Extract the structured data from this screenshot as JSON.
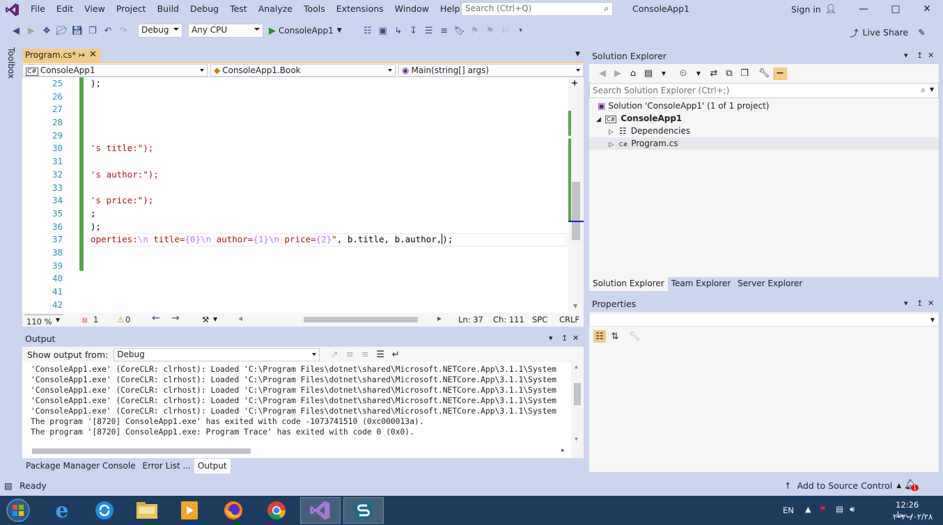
{
  "menubar": {
    "items": [
      "File",
      "Edit",
      "View",
      "Project",
      "Build",
      "Debug",
      "Test",
      "Analyze",
      "Tools",
      "Extensions",
      "Window",
      "Help"
    ],
    "search_placeholder": "Search (Ctrl+Q)",
    "app_title": "ConsoleApp1",
    "signin": "Sign in"
  },
  "toolbar": {
    "config": "Debug",
    "platform": "Any CPU",
    "run_target": "ConsoleApp1",
    "live_share": "Live Share"
  },
  "toolbox_label": "Toolbox",
  "editor": {
    "tab_label": "Program.cs*",
    "nav_project": "ConsoleApp1",
    "nav_class": "ConsoleApp1.Book",
    "nav_member": "Main(string[] args)",
    "line_numbers": [
      "25",
      "26",
      "27",
      "28",
      "29",
      "30",
      "31",
      "32",
      "33",
      "34",
      "35",
      "36",
      "37",
      "38",
      "39",
      "40",
      "41",
      "42"
    ],
    "lines": [
      ");",
      "",
      "",
      "",
      "",
      "'s title:\");",
      "",
      "'s author:\");",
      "",
      "'s price:\");",
      ";",
      ");",
      "",
      "",
      "",
      "",
      "",
      ""
    ],
    "line37": {
      "p1": "operties:",
      "p2": "\\n",
      "p3": " title=",
      "p4": "{0}",
      "p5": "\\n",
      "p6": " author=",
      "p7": "{1}",
      "p8": "\\n",
      "p9": " price=",
      "p10": "{2}",
      "p11": "\"",
      "p12": ", b.title, b.author,",
      "p13": ");"
    },
    "zoom": "110 %",
    "errors": "1",
    "warnings": "0",
    "ln": "Ln: 37",
    "ch": "Ch: 111",
    "spc": "SPC",
    "crlf": "CRLF"
  },
  "output": {
    "title": "Output",
    "show_from_label": "Show output from:",
    "source": "Debug",
    "lines": [
      "'ConsoleApp1.exe' (CoreCLR: clrhost): Loaded 'C:\\Program Files\\dotnet\\shared\\Microsoft.NETCore.App\\3.1.1\\System",
      "'ConsoleApp1.exe' (CoreCLR: clrhost): Loaded 'C:\\Program Files\\dotnet\\shared\\Microsoft.NETCore.App\\3.1.1\\System",
      "'ConsoleApp1.exe' (CoreCLR: clrhost): Loaded 'C:\\Program Files\\dotnet\\shared\\Microsoft.NETCore.App\\3.1.1\\System",
      "'ConsoleApp1.exe' (CoreCLR: clrhost): Loaded 'C:\\Program Files\\dotnet\\shared\\Microsoft.NETCore.App\\3.1.1\\System",
      "'ConsoleApp1.exe' (CoreCLR: clrhost): Loaded 'C:\\Program Files\\dotnet\\shared\\Microsoft.NETCore.App\\3.1.1\\System",
      "The program '[8720] ConsoleApp1.exe' has exited with code -1073741510 (0xc000013a).",
      "The program '[8720] ConsoleApp1.exe: Program Trace' has exited with code 0 (0x0)."
    ],
    "tabs": [
      "Package Manager Console",
      "Error List ...",
      "Output"
    ]
  },
  "solution_explorer": {
    "title": "Solution Explorer",
    "search_placeholder": "Search Solution Explorer (Ctrl+;)",
    "solution": "Solution 'ConsoleApp1' (1 of 1 project)",
    "project": "ConsoleApp1",
    "dependencies": "Dependencies",
    "file": "Program.cs",
    "tabs": [
      "Solution Explorer",
      "Team Explorer",
      "Server Explorer"
    ]
  },
  "properties": {
    "title": "Properties"
  },
  "statusbar": {
    "ready": "Ready",
    "source_control": "Add to Source Control",
    "notif_count": "1"
  },
  "taskbar": {
    "lang": "EN",
    "time": "12:26 ب.ظ",
    "date": "۲۰۲۰/۰۲/۲۸"
  },
  "colors": {
    "accent_tab": "#f5cc84",
    "chrome": "#ccd5f0",
    "taskbar": "#1c3d5e",
    "string": "#a31515",
    "escape": "#b776fb"
  }
}
